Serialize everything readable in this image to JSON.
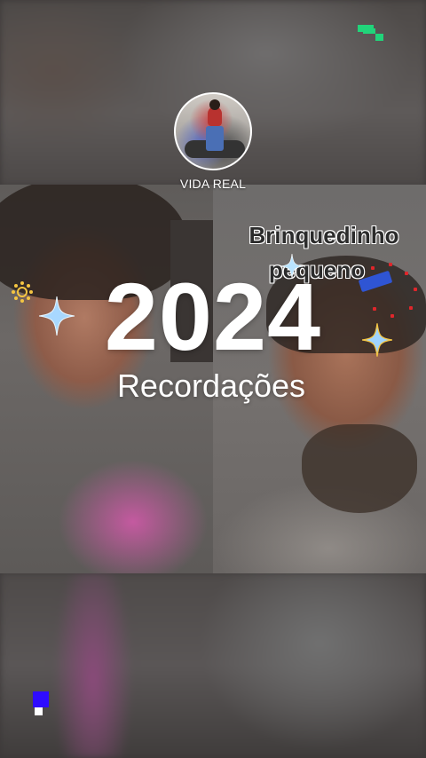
{
  "channel": {
    "name": "VIDA REAL"
  },
  "headline": {
    "year": "2024",
    "subtitle": "Recordações"
  },
  "sticker": {
    "line1": "Brinquedinho",
    "line2": "pequeno"
  },
  "icons": {
    "top_right": "app-logo-icon",
    "bottom_left": "blue-square-icon",
    "sparkle": "sparkle-icon",
    "sun": "sun-icon"
  },
  "colors": {
    "logo_green": "#21d47a",
    "accent_blue": "#2e0cff",
    "text_white": "#ffffff",
    "sparkle_blue": "#a8d8ff",
    "sparkle_gold": "#f4c542",
    "sticker_red": "#e0262b"
  }
}
